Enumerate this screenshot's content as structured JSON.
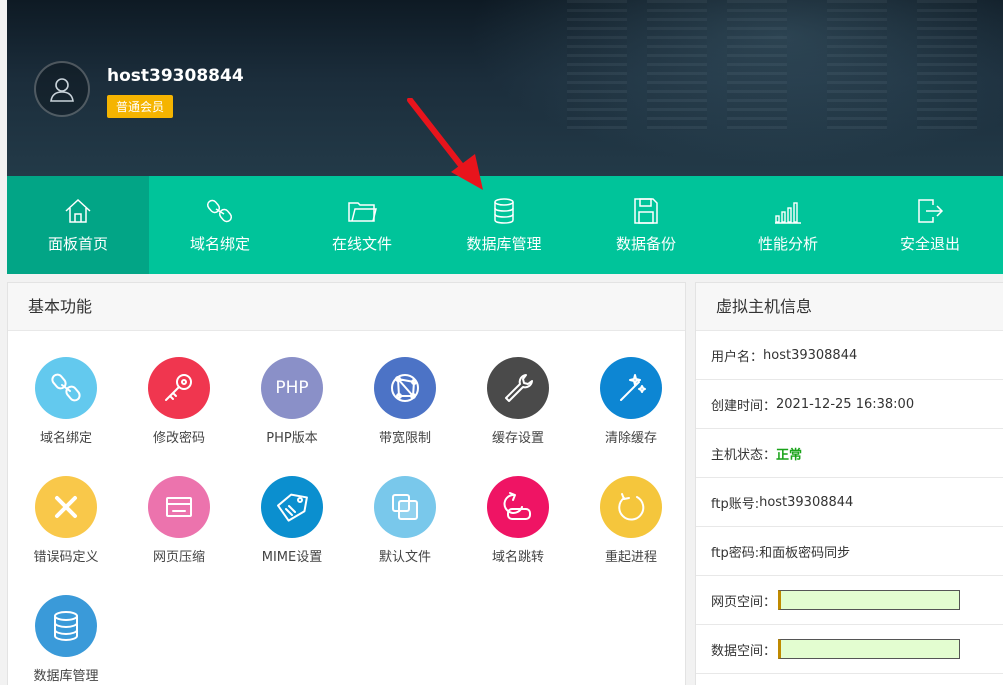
{
  "header": {
    "username": "host39308844",
    "badge": "普通会员"
  },
  "nav": {
    "items": [
      {
        "label": "面板首页",
        "icon": "home-icon"
      },
      {
        "label": "域名绑定",
        "icon": "link-icon"
      },
      {
        "label": "在线文件",
        "icon": "folder-icon"
      },
      {
        "label": "数据库管理",
        "icon": "database-icon"
      },
      {
        "label": "数据备份",
        "icon": "save-icon"
      },
      {
        "label": "性能分析",
        "icon": "bar-signal-icon"
      },
      {
        "label": "安全退出",
        "icon": "logout-icon"
      }
    ],
    "active_index": 0
  },
  "basic": {
    "title": "基本功能",
    "items": [
      {
        "label": "域名绑定",
        "icon": "link-icon",
        "color": "#63c9ee"
      },
      {
        "label": "修改密码",
        "icon": "key-icon",
        "color": "#f0364f"
      },
      {
        "label": "PHP版本",
        "icon": "php-icon",
        "icon_text": "PHP",
        "color": "#8a90c8"
      },
      {
        "label": "带宽限制",
        "icon": "network-icon",
        "color": "#4c73c6"
      },
      {
        "label": "缓存设置",
        "icon": "wrench-icon",
        "color": "#4a4a4a"
      },
      {
        "label": "清除缓存",
        "icon": "magic-wand-icon",
        "color": "#0d86d3"
      },
      {
        "label": "错误码定义",
        "icon": "close-icon",
        "color": "#f9c84a"
      },
      {
        "label": "网页压缩",
        "icon": "card-icon",
        "color": "#ec73ad"
      },
      {
        "label": "MIME设置",
        "icon": "tag-icon",
        "color": "#0b8fcf"
      },
      {
        "label": "默认文件",
        "icon": "copy-icon",
        "color": "#79c8eb"
      },
      {
        "label": "域名跳转",
        "icon": "redirect-icon",
        "color": "#ef1464"
      },
      {
        "label": "重起进程",
        "icon": "restart-icon",
        "color": "#f5c63c"
      },
      {
        "label": "数据库管理",
        "icon": "database-icon",
        "color": "#3a9ad9"
      }
    ]
  },
  "info": {
    "title": "虚拟主机信息",
    "rows": [
      {
        "label": "用户名：",
        "value": "host39308844"
      },
      {
        "label": "创建时间：",
        "value": "2021-12-25 16:38:00"
      },
      {
        "label": "主机状态：",
        "value": "正常"
      },
      {
        "label": "ftp账号:",
        "value": "host39308844"
      },
      {
        "label": "ftp密码:",
        "value": "和面板密码同步"
      },
      {
        "label": "网页空间：",
        "value": ""
      },
      {
        "label": "数据空间：",
        "value": ""
      }
    ],
    "status_color": "#1aa31a"
  }
}
